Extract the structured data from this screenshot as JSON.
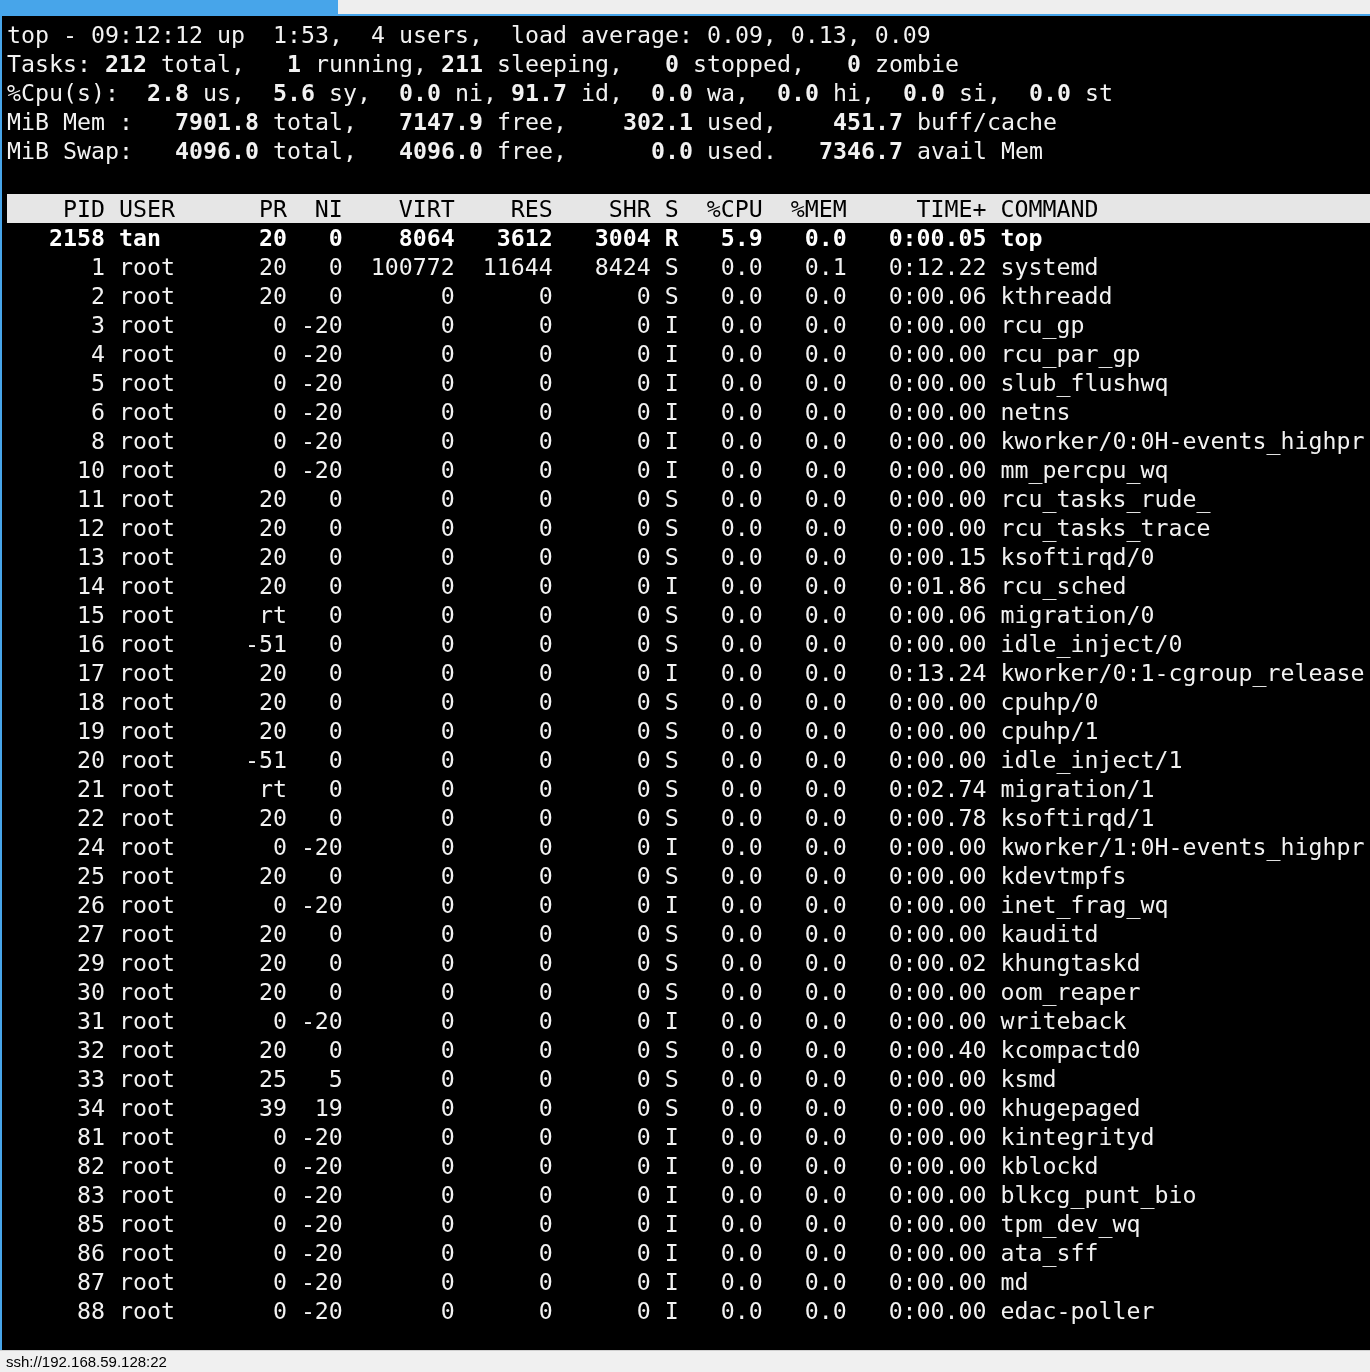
{
  "summary": [
    "top - 09:12:12 up  1:53,  4 users,  load average: 0.09, 0.13, 0.09",
    "Tasks: **212** total,   **1** running, **211** sleeping,   **0** stopped,   **0** zombie",
    "%Cpu(s):  **2.8** us,  **5.6** sy,  **0.0** ni, **91.7** id,  **0.0** wa,  **0.0** hi,  **0.0** si,  **0.0** st",
    "MiB Mem :   **7901.8** total,   **7147.9** free,    **302.1** used,    **451.7** buff/cache",
    "MiB Swap:   **4096.0** total,   **4096.0** free,      **0.0** used.   **7346.7** avail Mem"
  ],
  "table": {
    "columns": [
      "PID",
      "USER",
      "PR",
      "NI",
      "VIRT",
      "RES",
      "SHR",
      "S",
      "%CPU",
      "%MEM",
      "TIME+",
      "COMMAND"
    ],
    "rows": [
      {
        "highlighted": true,
        "cells": [
          "2158",
          "tan",
          "20",
          "0",
          "8064",
          "3612",
          "3004",
          "R",
          "5.9",
          "0.0",
          "0:00.05",
          "top"
        ]
      },
      {
        "highlighted": false,
        "cells": [
          "1",
          "root",
          "20",
          "0",
          "100772",
          "11644",
          "8424",
          "S",
          "0.0",
          "0.1",
          "0:12.22",
          "systemd"
        ]
      },
      {
        "highlighted": false,
        "cells": [
          "2",
          "root",
          "20",
          "0",
          "0",
          "0",
          "0",
          "S",
          "0.0",
          "0.0",
          "0:00.06",
          "kthreadd"
        ]
      },
      {
        "highlighted": false,
        "cells": [
          "3",
          "root",
          "0",
          "-20",
          "0",
          "0",
          "0",
          "I",
          "0.0",
          "0.0",
          "0:00.00",
          "rcu_gp"
        ]
      },
      {
        "highlighted": false,
        "cells": [
          "4",
          "root",
          "0",
          "-20",
          "0",
          "0",
          "0",
          "I",
          "0.0",
          "0.0",
          "0:00.00",
          "rcu_par_gp"
        ]
      },
      {
        "highlighted": false,
        "cells": [
          "5",
          "root",
          "0",
          "-20",
          "0",
          "0",
          "0",
          "I",
          "0.0",
          "0.0",
          "0:00.00",
          "slub_flushwq"
        ]
      },
      {
        "highlighted": false,
        "cells": [
          "6",
          "root",
          "0",
          "-20",
          "0",
          "0",
          "0",
          "I",
          "0.0",
          "0.0",
          "0:00.00",
          "netns"
        ]
      },
      {
        "highlighted": false,
        "cells": [
          "8",
          "root",
          "0",
          "-20",
          "0",
          "0",
          "0",
          "I",
          "0.0",
          "0.0",
          "0:00.00",
          "kworker/0:0H-events_highpr"
        ]
      },
      {
        "highlighted": false,
        "cells": [
          "10",
          "root",
          "0",
          "-20",
          "0",
          "0",
          "0",
          "I",
          "0.0",
          "0.0",
          "0:00.00",
          "mm_percpu_wq"
        ]
      },
      {
        "highlighted": false,
        "cells": [
          "11",
          "root",
          "20",
          "0",
          "0",
          "0",
          "0",
          "S",
          "0.0",
          "0.0",
          "0:00.00",
          "rcu_tasks_rude_"
        ]
      },
      {
        "highlighted": false,
        "cells": [
          "12",
          "root",
          "20",
          "0",
          "0",
          "0",
          "0",
          "S",
          "0.0",
          "0.0",
          "0:00.00",
          "rcu_tasks_trace"
        ]
      },
      {
        "highlighted": false,
        "cells": [
          "13",
          "root",
          "20",
          "0",
          "0",
          "0",
          "0",
          "S",
          "0.0",
          "0.0",
          "0:00.15",
          "ksoftirqd/0"
        ]
      },
      {
        "highlighted": false,
        "cells": [
          "14",
          "root",
          "20",
          "0",
          "0",
          "0",
          "0",
          "I",
          "0.0",
          "0.0",
          "0:01.86",
          "rcu_sched"
        ]
      },
      {
        "highlighted": false,
        "cells": [
          "15",
          "root",
          "rt",
          "0",
          "0",
          "0",
          "0",
          "S",
          "0.0",
          "0.0",
          "0:00.06",
          "migration/0"
        ]
      },
      {
        "highlighted": false,
        "cells": [
          "16",
          "root",
          "-51",
          "0",
          "0",
          "0",
          "0",
          "S",
          "0.0",
          "0.0",
          "0:00.00",
          "idle_inject/0"
        ]
      },
      {
        "highlighted": false,
        "cells": [
          "17",
          "root",
          "20",
          "0",
          "0",
          "0",
          "0",
          "I",
          "0.0",
          "0.0",
          "0:13.24",
          "kworker/0:1-cgroup_release"
        ]
      },
      {
        "highlighted": false,
        "cells": [
          "18",
          "root",
          "20",
          "0",
          "0",
          "0",
          "0",
          "S",
          "0.0",
          "0.0",
          "0:00.00",
          "cpuhp/0"
        ]
      },
      {
        "highlighted": false,
        "cells": [
          "19",
          "root",
          "20",
          "0",
          "0",
          "0",
          "0",
          "S",
          "0.0",
          "0.0",
          "0:00.00",
          "cpuhp/1"
        ]
      },
      {
        "highlighted": false,
        "cells": [
          "20",
          "root",
          "-51",
          "0",
          "0",
          "0",
          "0",
          "S",
          "0.0",
          "0.0",
          "0:00.00",
          "idle_inject/1"
        ]
      },
      {
        "highlighted": false,
        "cells": [
          "21",
          "root",
          "rt",
          "0",
          "0",
          "0",
          "0",
          "S",
          "0.0",
          "0.0",
          "0:02.74",
          "migration/1"
        ]
      },
      {
        "highlighted": false,
        "cells": [
          "22",
          "root",
          "20",
          "0",
          "0",
          "0",
          "0",
          "S",
          "0.0",
          "0.0",
          "0:00.78",
          "ksoftirqd/1"
        ]
      },
      {
        "highlighted": false,
        "cells": [
          "24",
          "root",
          "0",
          "-20",
          "0",
          "0",
          "0",
          "I",
          "0.0",
          "0.0",
          "0:00.00",
          "kworker/1:0H-events_highpr"
        ]
      },
      {
        "highlighted": false,
        "cells": [
          "25",
          "root",
          "20",
          "0",
          "0",
          "0",
          "0",
          "S",
          "0.0",
          "0.0",
          "0:00.00",
          "kdevtmpfs"
        ]
      },
      {
        "highlighted": false,
        "cells": [
          "26",
          "root",
          "0",
          "-20",
          "0",
          "0",
          "0",
          "I",
          "0.0",
          "0.0",
          "0:00.00",
          "inet_frag_wq"
        ]
      },
      {
        "highlighted": false,
        "cells": [
          "27",
          "root",
          "20",
          "0",
          "0",
          "0",
          "0",
          "S",
          "0.0",
          "0.0",
          "0:00.00",
          "kauditd"
        ]
      },
      {
        "highlighted": false,
        "cells": [
          "29",
          "root",
          "20",
          "0",
          "0",
          "0",
          "0",
          "S",
          "0.0",
          "0.0",
          "0:00.02",
          "khungtaskd"
        ]
      },
      {
        "highlighted": false,
        "cells": [
          "30",
          "root",
          "20",
          "0",
          "0",
          "0",
          "0",
          "S",
          "0.0",
          "0.0",
          "0:00.00",
          "oom_reaper"
        ]
      },
      {
        "highlighted": false,
        "cells": [
          "31",
          "root",
          "0",
          "-20",
          "0",
          "0",
          "0",
          "I",
          "0.0",
          "0.0",
          "0:00.00",
          "writeback"
        ]
      },
      {
        "highlighted": false,
        "cells": [
          "32",
          "root",
          "20",
          "0",
          "0",
          "0",
          "0",
          "S",
          "0.0",
          "0.0",
          "0:00.40",
          "kcompactd0"
        ]
      },
      {
        "highlighted": false,
        "cells": [
          "33",
          "root",
          "25",
          "5",
          "0",
          "0",
          "0",
          "S",
          "0.0",
          "0.0",
          "0:00.00",
          "ksmd"
        ]
      },
      {
        "highlighted": false,
        "cells": [
          "34",
          "root",
          "39",
          "19",
          "0",
          "0",
          "0",
          "S",
          "0.0",
          "0.0",
          "0:00.00",
          "khugepaged"
        ]
      },
      {
        "highlighted": false,
        "cells": [
          "81",
          "root",
          "0",
          "-20",
          "0",
          "0",
          "0",
          "I",
          "0.0",
          "0.0",
          "0:00.00",
          "kintegrityd"
        ]
      },
      {
        "highlighted": false,
        "cells": [
          "82",
          "root",
          "0",
          "-20",
          "0",
          "0",
          "0",
          "I",
          "0.0",
          "0.0",
          "0:00.00",
          "kblockd"
        ]
      },
      {
        "highlighted": false,
        "cells": [
          "83",
          "root",
          "0",
          "-20",
          "0",
          "0",
          "0",
          "I",
          "0.0",
          "0.0",
          "0:00.00",
          "blkcg_punt_bio"
        ]
      },
      {
        "highlighted": false,
        "cells": [
          "85",
          "root",
          "0",
          "-20",
          "0",
          "0",
          "0",
          "I",
          "0.0",
          "0.0",
          "0:00.00",
          "tpm_dev_wq"
        ]
      },
      {
        "highlighted": false,
        "cells": [
          "86",
          "root",
          "0",
          "-20",
          "0",
          "0",
          "0",
          "I",
          "0.0",
          "0.0",
          "0:00.00",
          "ata_sff"
        ]
      },
      {
        "highlighted": false,
        "cells": [
          "87",
          "root",
          "0",
          "-20",
          "0",
          "0",
          "0",
          "I",
          "0.0",
          "0.0",
          "0:00.00",
          "md"
        ]
      },
      {
        "highlighted": false,
        "cells": [
          "88",
          "root",
          "0",
          "-20",
          "0",
          "0",
          "0",
          "I",
          "0.0",
          "0.0",
          "0:00.00",
          "edac-poller"
        ]
      }
    ]
  },
  "status_bar": "ssh://192.168.59.128:22"
}
